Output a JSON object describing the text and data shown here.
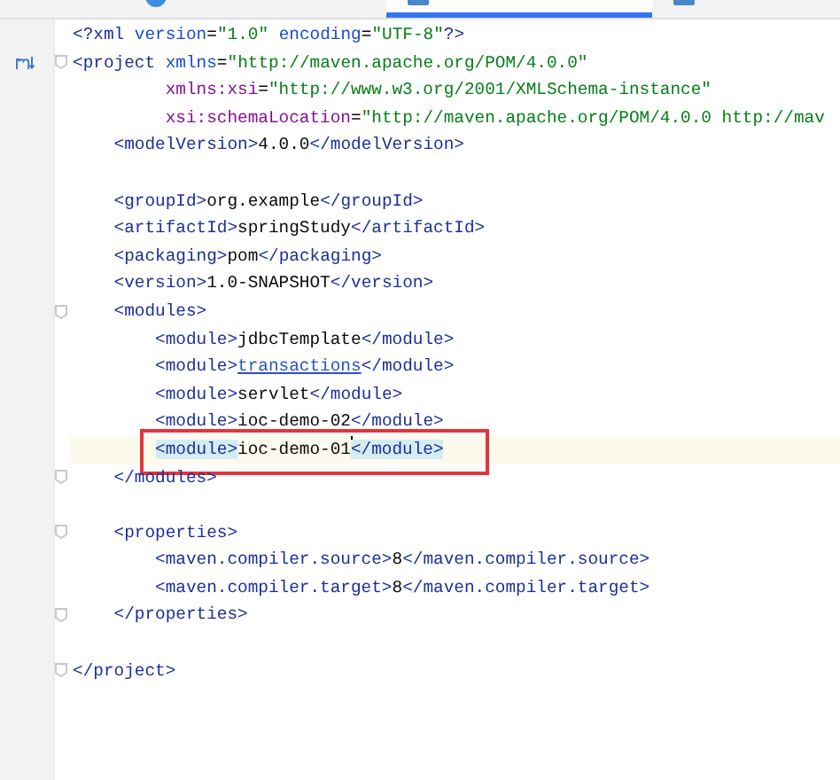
{
  "tabs": [
    {
      "selected": false
    },
    {
      "selected": true
    },
    {
      "selected": false
    }
  ],
  "editor": {
    "lines": [
      {
        "text": "<?xml version=\"1.0\" encoding=\"UTF-8\"?>",
        "fold": false,
        "current": false,
        "boxed": false
      },
      {
        "text": "<project xmlns=\"http://maven.apache.org/POM/4.0.0\"",
        "fold": true,
        "current": false,
        "boxed": false
      },
      {
        "text": "         xmlns:xsi=\"http://www.w3.org/2001/XMLSchema-instance\"",
        "fold": false,
        "current": false,
        "boxed": false
      },
      {
        "text": "         xsi:schemaLocation=\"http://maven.apache.org/POM/4.0.0 http://mav",
        "fold": false,
        "current": false,
        "boxed": false
      },
      {
        "text": "    <modelVersion>4.0.0</modelVersion>",
        "fold": false,
        "current": false,
        "boxed": false
      },
      {
        "fold": false,
        "current": false,
        "boxed": false
      },
      {
        "text": "    <groupId>org.example</groupId>",
        "fold": false,
        "current": false,
        "boxed": false
      },
      {
        "text": "    <artifactId>springStudy</artifactId>",
        "fold": false,
        "current": false,
        "boxed": false
      },
      {
        "text": "    <packaging>pom</packaging>",
        "fold": false,
        "current": false,
        "boxed": false
      },
      {
        "text": "    <version>1.0-SNAPSHOT</version>",
        "fold": false,
        "current": false,
        "boxed": false
      },
      {
        "text": "    <modules>",
        "fold": true,
        "current": false,
        "boxed": false
      },
      {
        "text": "        <module>jdbcTemplate</module>",
        "fold": false,
        "current": false,
        "boxed": false
      },
      {
        "text": "        <module>transactions</module>",
        "link": true,
        "fold": false,
        "current": false,
        "boxed": false
      },
      {
        "text": "        <module>servlet</module>",
        "fold": false,
        "current": false,
        "boxed": false
      },
      {
        "text": "        <module>ioc-demo-02</module>",
        "fold": false,
        "current": false,
        "boxed": false
      },
      {
        "text": "        <module>ioc-demo-01</module>",
        "matched": true,
        "caret": true,
        "fold": false,
        "current": true,
        "boxed": true
      },
      {
        "text": "    </modules>",
        "fold": true,
        "current": false,
        "boxed": false
      },
      {
        "fold": false,
        "current": false,
        "boxed": false
      },
      {
        "text": "    <properties>",
        "fold": true,
        "current": false,
        "boxed": false
      },
      {
        "text": "        <maven.compiler.source>8</maven.compiler.source>",
        "fold": false,
        "current": false,
        "boxed": false
      },
      {
        "text": "        <maven.compiler.target>8</maven.compiler.target>",
        "fold": false,
        "current": false,
        "boxed": false
      },
      {
        "text": "    </properties>",
        "fold": true,
        "current": false,
        "boxed": false
      },
      {
        "fold": false,
        "current": false,
        "boxed": false
      },
      {
        "text": "</project>",
        "fold": true,
        "current": false,
        "boxed": false
      }
    ]
  }
}
